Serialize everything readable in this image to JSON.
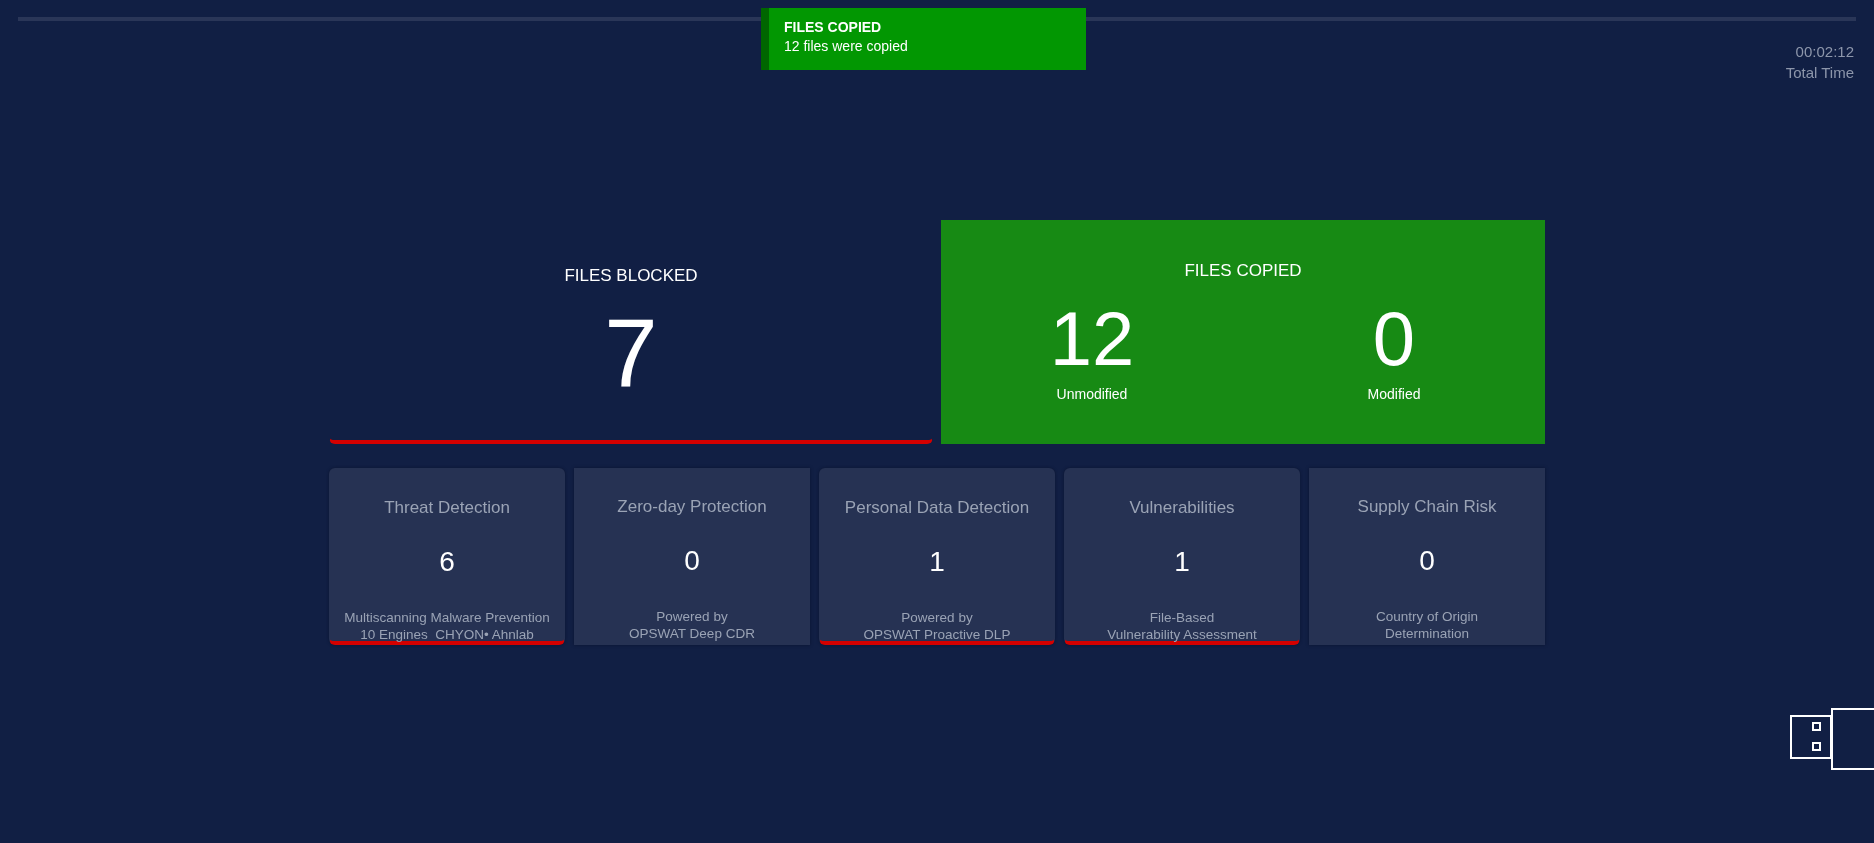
{
  "toast": {
    "title": "FILES COPIED",
    "message": "12 files were copied"
  },
  "timer": {
    "value": "00:02:12",
    "label": "Total Time"
  },
  "blocked": {
    "title": "FILES BLOCKED",
    "count": "7",
    "alert": true
  },
  "copied": {
    "title": "FILES COPIED",
    "stats": [
      {
        "value": "12",
        "label": "Unmodified"
      },
      {
        "value": "0",
        "label": "Modified"
      }
    ]
  },
  "cards": [
    {
      "title": "Threat Detection",
      "count": "6",
      "lines": [
        "Multiscanning Malware Prevention",
        "10 Engines  CHYON• Ahnlab"
      ],
      "alert": true
    },
    {
      "title": "Zero-day Protection",
      "count": "0",
      "lines": [
        "Powered by",
        "OPSWAT Deep CDR"
      ],
      "alert": false
    },
    {
      "title": "Personal Data Detection",
      "count": "1",
      "lines": [
        "Powered by",
        "OPSWAT Proactive DLP"
      ],
      "alert": true
    },
    {
      "title": "Vulnerabilities",
      "count": "1",
      "lines": [
        "File-Based",
        "Vulnerability Assessment"
      ],
      "alert": true
    },
    {
      "title": "Supply Chain Risk",
      "count": "0",
      "lines": [
        "Country of Origin",
        "Determination"
      ],
      "alert": false
    }
  ]
}
